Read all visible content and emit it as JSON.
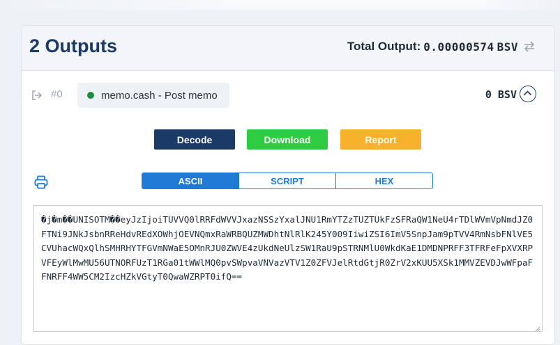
{
  "header": {
    "title": "2 Outputs",
    "total_label": "Total Output:",
    "total_value": "0.00000574",
    "total_unit": "BSV",
    "swap_icon": "swap-arrows-icon"
  },
  "output": {
    "index": "#0",
    "type_label": "memo.cash - Post memo",
    "amount": "0 BSV",
    "status_color": "#1e8e3e"
  },
  "buttons": {
    "decode": "Decode",
    "download": "Download",
    "report": "Report"
  },
  "tabs": [
    {
      "label": "ASCII",
      "active": true
    },
    {
      "label": "SCRIPT",
      "active": false
    },
    {
      "label": "HEX",
      "active": false
    }
  ],
  "payload_text": "�j�m��UNISOTM��eyJzIjoiTUVVQ0lRRFdWVVJxazNSSzYxalJNU1RmYTZzTUZTUkFzSFRaQW1NeU4rTDlWVmVpNmdJZ0FTNi9JNkJsbnRReHdvREdXOWhjOEVNQmxRaWRBQUZMWDhtNlRlK245Y009IiwiZSI6ImV5SnpJam9pTVV4RmNsbFNlVE5CVUhacWQxQlhSMHRHYTFGVmNWaE5OMnRJU0ZWVE4zUkdNeUlzSW1RaU9pSTRNMlU0WkdKaE1DMDNPRFF3TFRFeFpXVXRPVFEyWlMwMU56UTNORFUzT1RGa01tWWlMQ0pvSWpvaVNVazVTV1Z0ZFVJelRtdGtjR0ZrV2xKUU5XSk1MMVZEVDJwWFpaFFNRFF4WW5CM2IzcHZkVGtyT0QwaWZRPT0ifQ=="
}
